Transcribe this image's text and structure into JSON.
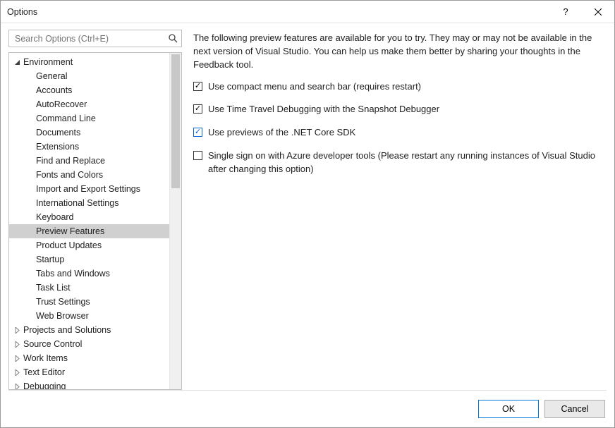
{
  "window": {
    "title": "Options"
  },
  "search": {
    "placeholder": "Search Options (Ctrl+E)"
  },
  "tree": {
    "environment": {
      "label": "Environment",
      "children": [
        "General",
        "Accounts",
        "AutoRecover",
        "Command Line",
        "Documents",
        "Extensions",
        "Find and Replace",
        "Fonts and Colors",
        "Import and Export Settings",
        "International Settings",
        "Keyboard",
        "Preview Features",
        "Product Updates",
        "Startup",
        "Tabs and Windows",
        "Task List",
        "Trust Settings",
        "Web Browser"
      ],
      "selected": "Preview Features"
    },
    "roots": [
      "Projects and Solutions",
      "Source Control",
      "Work Items",
      "Text Editor",
      "Debugging"
    ]
  },
  "content": {
    "intro": "The following preview features are available for you to try. They may or may not be available in the next version of Visual Studio. You can help us make them better by sharing your thoughts in the Feedback tool.",
    "options": [
      {
        "label": "Use compact menu and search bar (requires restart)",
        "checked": true,
        "blue": false
      },
      {
        "label": "Use Time Travel Debugging with the Snapshot Debugger",
        "checked": true,
        "blue": false
      },
      {
        "label": "Use previews of the .NET Core SDK",
        "checked": true,
        "blue": true
      },
      {
        "label": "Single sign on with Azure developer tools (Please restart any running instances of Visual Studio after changing this option)",
        "checked": false,
        "blue": false
      }
    ]
  },
  "buttons": {
    "ok": "OK",
    "cancel": "Cancel"
  }
}
